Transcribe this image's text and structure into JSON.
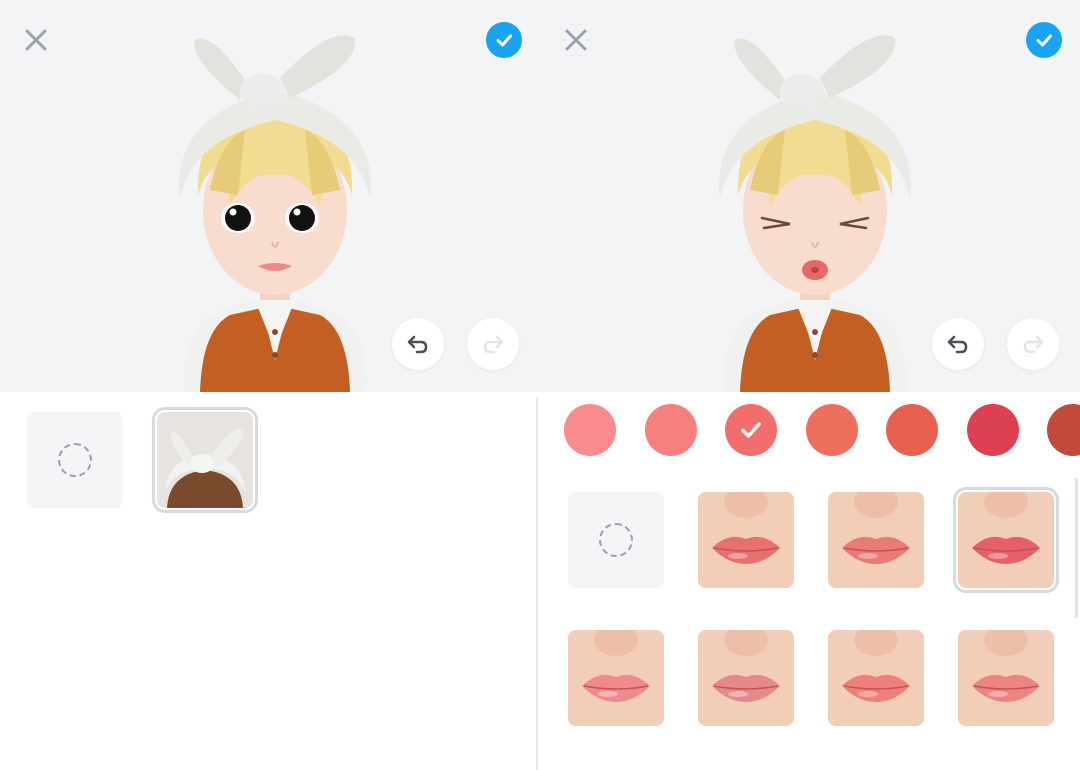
{
  "screens": [
    {
      "id": "headwear",
      "toolbar": {
        "close_icon": "close-icon",
        "confirm_icon": "check-circle-icon",
        "undo_icon": "undo-icon",
        "redo_icon": "redo-icon"
      },
      "avatar_expression": "neutral",
      "items": [
        {
          "type": "none",
          "icon": "none-dashed-circle-icon",
          "selected": false
        },
        {
          "type": "headband-bow",
          "selected": true
        }
      ]
    },
    {
      "id": "lips",
      "toolbar": {
        "close_icon": "close-icon",
        "confirm_icon": "check-circle-icon",
        "undo_icon": "undo-icon",
        "redo_icon": "redo-icon"
      },
      "avatar_expression": "kiss-eyes-closed",
      "colors": [
        "#f98b8e",
        "#f6807d",
        "#f26e6e",
        "#ef6f5d",
        "#e8604f",
        "#dc4052",
        "#c24a3a"
      ],
      "selected_color_index": 2,
      "items": [
        {
          "type": "none",
          "icon": "none-dashed-circle-icon",
          "selected": false
        },
        {
          "type": "lips-style-1",
          "selected": false
        },
        {
          "type": "lips-style-2",
          "selected": false
        },
        {
          "type": "lips-style-3",
          "selected": true
        },
        {
          "type": "lips-style-4",
          "selected": false
        },
        {
          "type": "lips-style-5",
          "selected": false
        },
        {
          "type": "lips-style-6",
          "selected": false
        },
        {
          "type": "lips-style-7",
          "selected": false
        }
      ]
    }
  ]
}
